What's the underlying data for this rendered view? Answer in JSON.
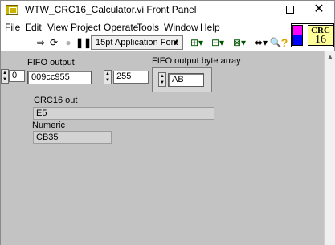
{
  "window": {
    "title": "WTW_CRC16_Calculator.vi Front Panel",
    "minimize": "—",
    "close": "✕"
  },
  "menu": [
    "File",
    "Edit",
    "View",
    "Project",
    "Operate",
    "Tools",
    "Window",
    "Help"
  ],
  "toolbar": {
    "run_icon": "run-arrow-icon",
    "font": "15pt Application Font"
  },
  "vi_icon": {
    "line1": "CRC",
    "line2": "16"
  },
  "panel": {
    "fifo_output": {
      "label": "FIFO output",
      "index": "0",
      "value": "009cc955"
    },
    "fifo_byte_array": {
      "label": "FIFO output byte array",
      "index": "255",
      "value": "AB"
    },
    "crc16_out": {
      "label": "CRC16 out",
      "value": "E5"
    },
    "numeric": {
      "label": "Numeric",
      "value": "CB35"
    }
  },
  "colors": {
    "panel": "#c3c3c3",
    "indicator": "#d3d3d3",
    "connector_top": "#ff00ff",
    "connector_bottom": "#0000ff"
  }
}
